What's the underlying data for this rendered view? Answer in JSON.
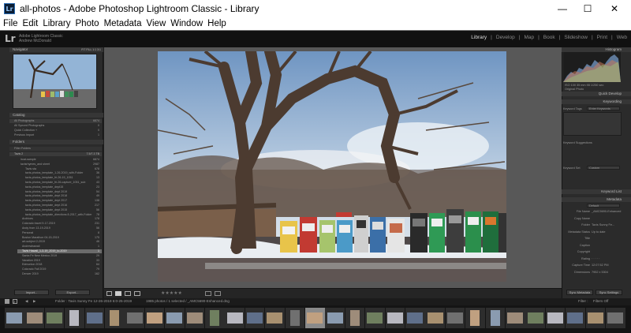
{
  "window": {
    "app_icon": "Lr",
    "title": "all-photos - Adobe Photoshop Lightroom Classic - Library",
    "controls": {
      "minimize": "—",
      "maximize": "☐",
      "close": "✕"
    }
  },
  "menu": [
    "File",
    "Edit",
    "Library",
    "Photo",
    "Metadata",
    "View",
    "Window",
    "Help"
  ],
  "identity": {
    "logo": "Lr",
    "line1": "Adobe Lightroom Classic",
    "line2": "Andrew McDonald"
  },
  "modules": [
    {
      "label": "Library",
      "active": true
    },
    {
      "label": "Develop",
      "active": false
    },
    {
      "label": "Map",
      "active": false
    },
    {
      "label": "Book",
      "active": false
    },
    {
      "label": "Slideshow",
      "active": false
    },
    {
      "label": "Print",
      "active": false
    },
    {
      "label": "Web",
      "active": false
    }
  ],
  "left_panel": {
    "navigator": {
      "title": "Navigator",
      "zoom": [
        "FIT",
        "FILL",
        "1:1",
        "3:1"
      ]
    },
    "catalog": {
      "title": "Catalog",
      "items": [
        {
          "label": "All Photographs",
          "count": "6874"
        },
        {
          "label": "All Synced Photographs",
          "count": "0"
        },
        {
          "label": "Quick Collection +",
          "count": "0"
        },
        {
          "label": "Previous Import",
          "count": "1"
        }
      ]
    },
    "folders": {
      "title": "Folders",
      "filter": "Filter Folders",
      "volume": {
        "label": "Tavis 2",
        "count": "7.5/7.3 TB"
      },
      "items": [
        {
          "label": "lrcat-sample",
          "count": "6874"
        },
        {
          "label": "tavisrhymes_and sheet",
          "count": "2987"
        },
        {
          "label": "Tavis sta",
          "count": "678"
        },
        {
          "label": "tavis-photos_template_1-26-2019_with-Folder",
          "count": "36"
        },
        {
          "label": "tavis-photos_template_fri-26-19_1051",
          "count": "13"
        },
        {
          "label": "tavis-photos_template_fri-26-capture_1051_sub",
          "count": "43"
        },
        {
          "label": "tavis-photos_template_dept15",
          "count": "23"
        },
        {
          "label": "tavis-photos_template_dept 2019",
          "count": "54"
        },
        {
          "label": "tavis-photos_template_dept 2018",
          "count": "49"
        },
        {
          "label": "tavis-photos_template_dept 2017",
          "count": "138"
        },
        {
          "label": "tavis-photos_template_dept 2016",
          "count": "217"
        },
        {
          "label": "tavis-photos_template_dept 2015",
          "count": "56"
        },
        {
          "label": "tavis-photos_template_directions 8-2017_with-Folder",
          "count": "78"
        },
        {
          "label": "Archives",
          "count": "178"
        },
        {
          "label": "Colorado travel 9-17-2019",
          "count": "231"
        },
        {
          "label": "Andy from 13-19-2019",
          "count": "56"
        },
        {
          "label": "Personal",
          "count": "8"
        },
        {
          "label": "Boston Marathon 04-15-2019",
          "count": "175"
        },
        {
          "label": "art-subject 2-2019",
          "count": "46"
        },
        {
          "label": "Andrewhawaii",
          "count": "1"
        },
        {
          "label": "Tavis Hawaii_1-3-19_2019_to-2019",
          "count": "1"
        },
        {
          "label": "Santa Fe New Mexico 2019",
          "count": "29"
        },
        {
          "label": "Vacation 2019",
          "count": "33"
        },
        {
          "label": "Edmonton 2018",
          "count": "64"
        },
        {
          "label": "Colorado Fall 2019",
          "count": "79"
        },
        {
          "label": "Denver 2019",
          "count": "162"
        }
      ]
    },
    "buttons": {
      "import": "Import...",
      "export": "Export..."
    }
  },
  "right_panel": {
    "histogram": {
      "title": "Histogram",
      "readout": "ISO 100   35 mm   f/8   1/250 sec",
      "original": "Original Photo"
    },
    "quick_develop": {
      "title": "Quick Develop",
      "preset": "Custom"
    },
    "keywording": {
      "title": "Keywording",
      "tags_label": "Keyword Tags",
      "tags_value": "Enter Keywords",
      "suggestions": "Keyword Suggestions",
      "keyword_set": "Keyword Set",
      "set_value": "Custom"
    },
    "keyword_list": {
      "title": "Keyword List"
    },
    "metadata": {
      "title": "Metadata",
      "preset_label": "Default",
      "fields": [
        {
          "label": "File Name",
          "value": "_AMC5690-Enhanced"
        },
        {
          "label": "Copy Name",
          "value": ""
        },
        {
          "label": "Folder",
          "value": "Tavis Sunny Fe..."
        },
        {
          "label": "Metadata Status",
          "value": "Up to date"
        },
        {
          "label": "Title",
          "value": ""
        },
        {
          "label": "Caption",
          "value": ""
        },
        {
          "label": "Copyright",
          "value": ""
        },
        {
          "label": "Rating",
          "value": "· · · · ·"
        },
        {
          "label": "Capture Time",
          "value": "12:07:52 PM"
        },
        {
          "label": "Dimensions",
          "value": "7952 x 5304"
        }
      ]
    },
    "buttons": {
      "sync": "Sync Metadata",
      "sync_settings": "Sync Settings"
    }
  },
  "toolbar": {
    "stars": "★★★★★",
    "views": [
      "grid-view",
      "loupe-view",
      "compare-view",
      "survey-view"
    ]
  },
  "filmstrip_header": {
    "pages": [
      "1",
      "2"
    ],
    "source": "Folder : Tavis Sunny Fe 12-26-2019 6:0-25-2019",
    "count": "1985 photos / 1 selected / _AMC5690-Enhanced.dng",
    "filter_label": "Filter :",
    "filter_value": "Filters Off"
  },
  "filmstrip": {
    "count": 31,
    "selected_index": 15
  },
  "colors": {
    "bg": "#1f1f1f",
    "panel": "#2b2b2b",
    "center_bg": "#585858",
    "active_module": "#dddddd"
  }
}
